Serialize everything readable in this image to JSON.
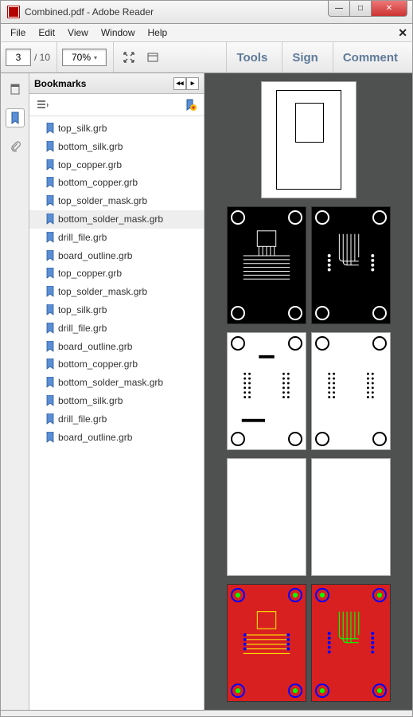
{
  "window": {
    "title": "Combined.pdf - Adobe Reader"
  },
  "menu": {
    "items": [
      "File",
      "Edit",
      "View",
      "Window",
      "Help"
    ]
  },
  "toolbar": {
    "page_current": "3",
    "page_total": "/ 10",
    "zoom": "70%",
    "tools": "Tools",
    "sign": "Sign",
    "comment": "Comment"
  },
  "bookmarks": {
    "title": "Bookmarks",
    "items": [
      {
        "label": "top_silk.grb"
      },
      {
        "label": "bottom_silk.grb"
      },
      {
        "label": "top_copper.grb"
      },
      {
        "label": "bottom_copper.grb"
      },
      {
        "label": "top_solder_mask.grb"
      },
      {
        "label": "bottom_solder_mask.grb",
        "selected": true
      },
      {
        "label": "drill_file.grb"
      },
      {
        "label": "board_outline.grb"
      },
      {
        "label": "top_copper.grb"
      },
      {
        "label": "top_solder_mask.grb"
      },
      {
        "label": "top_silk.grb"
      },
      {
        "label": "drill_file.grb"
      },
      {
        "label": "board_outline.grb"
      },
      {
        "label": "bottom_copper.grb"
      },
      {
        "label": "bottom_solder_mask.grb"
      },
      {
        "label": "bottom_silk.grb"
      },
      {
        "label": "drill_file.grb"
      },
      {
        "label": "board_outline.grb"
      }
    ]
  }
}
